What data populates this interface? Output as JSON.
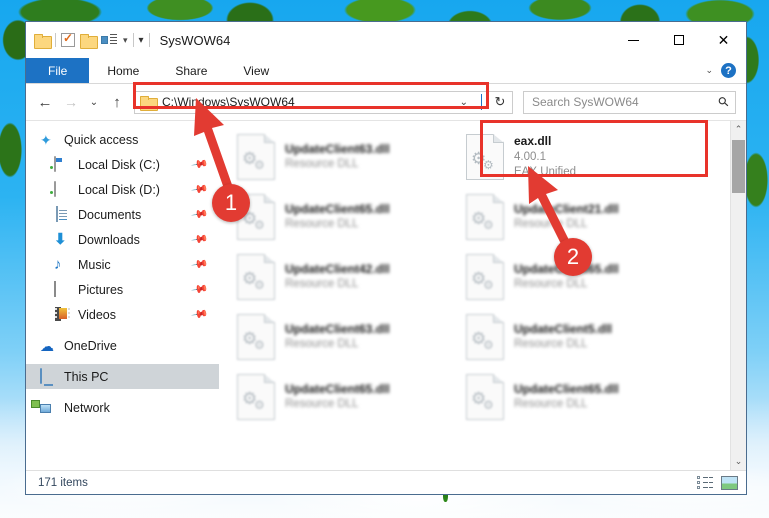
{
  "window": {
    "title": "SysWOW64",
    "quick_access_icons": [
      "folder-icon",
      "properties-icon",
      "new-folder-icon",
      "customize-ribbon-icon"
    ],
    "controls": {
      "minimize": "minimize",
      "maximize": "maximize",
      "close": "close"
    }
  },
  "ribbon": {
    "tabs": [
      {
        "label": "File",
        "active": true
      },
      {
        "label": "Home",
        "active": false
      },
      {
        "label": "Share",
        "active": false
      },
      {
        "label": "View",
        "active": false
      }
    ],
    "expand_label": "⌄",
    "help_label": "?"
  },
  "navigation": {
    "back": "←",
    "forward": "→",
    "recent": "⌄",
    "up": "↑",
    "address": {
      "value": "C:\\Windows\\SysWOW64",
      "chevron": "⌄",
      "refresh": "↻"
    },
    "search": {
      "placeholder": "Search SysWOW64",
      "value": "",
      "icon": "⚲"
    }
  },
  "sidebar": {
    "items": [
      {
        "label": "Quick access",
        "icon": "star-icon",
        "level": "root",
        "pinned": false,
        "selected": false
      },
      {
        "label": "Local Disk (C:)",
        "icon": "drive-icon",
        "level": "child",
        "pinned": true,
        "selected": false
      },
      {
        "label": "Local Disk (D:)",
        "icon": "drive-icon",
        "level": "child",
        "pinned": true,
        "selected": false
      },
      {
        "label": "Documents",
        "icon": "documents-icon",
        "level": "child",
        "pinned": true,
        "selected": false
      },
      {
        "label": "Downloads",
        "icon": "downloads-icon",
        "level": "child",
        "pinned": true,
        "selected": false
      },
      {
        "label": "Music",
        "icon": "music-icon",
        "level": "child",
        "pinned": true,
        "selected": false
      },
      {
        "label": "Pictures",
        "icon": "pictures-icon",
        "level": "child",
        "pinned": true,
        "selected": false
      },
      {
        "label": "Videos",
        "icon": "videos-icon",
        "level": "child",
        "pinned": true,
        "selected": false
      },
      {
        "label": "OneDrive",
        "icon": "cloud-icon",
        "level": "root",
        "pinned": false,
        "selected": false
      },
      {
        "label": "This PC",
        "icon": "this-pc-icon",
        "level": "root",
        "pinned": false,
        "selected": true
      },
      {
        "label": "Network",
        "icon": "network-icon",
        "level": "root",
        "pinned": false,
        "selected": false
      }
    ],
    "pin_glyph": "📌"
  },
  "files": [
    {
      "name": "UpdateClient63.dll",
      "line2": "Resource DLL",
      "line3": "",
      "icon": "dll-file-icon",
      "blurred": true,
      "highlighted": false
    },
    {
      "name": "eax.dll",
      "line2": "4.00.1",
      "line3": "EAX Unified",
      "icon": "dll-file-icon",
      "blurred": false,
      "highlighted": true
    },
    {
      "name": "UpdateClient65.dll",
      "line2": "Resource DLL",
      "line3": "",
      "icon": "dll-file-icon",
      "blurred": true,
      "highlighted": false
    },
    {
      "name": "UpdateClient21.dll",
      "line2": "Resource DLL",
      "line3": "",
      "icon": "dll-file-icon",
      "blurred": true,
      "highlighted": false
    },
    {
      "name": "UpdateClient42.dll",
      "line2": "Resource DLL",
      "line3": "",
      "icon": "dll-file-icon",
      "blurred": true,
      "highlighted": false
    },
    {
      "name": "UpdateClient65.dll",
      "line2": "Resource DLL",
      "line3": "",
      "icon": "dll-file-icon",
      "blurred": true,
      "highlighted": false
    },
    {
      "name": "UpdateClient63.dll",
      "line2": "Resource DLL",
      "line3": "",
      "icon": "dll-file-icon",
      "blurred": true,
      "highlighted": false
    },
    {
      "name": "UpdateClient5.dll",
      "line2": "Resource DLL",
      "line3": "",
      "icon": "dll-file-icon",
      "blurred": true,
      "highlighted": false
    },
    {
      "name": "UpdateClient65.dll",
      "line2": "Resource DLL",
      "line3": "",
      "icon": "dll-file-icon",
      "blurred": true,
      "highlighted": false
    },
    {
      "name": "UpdateClient65.dll",
      "line2": "Resource DLL",
      "line3": "",
      "icon": "dll-file-icon",
      "blurred": true,
      "highlighted": false
    }
  ],
  "statusbar": {
    "item_count": "171 items",
    "view_details_label": "details-view",
    "view_tiles_label": "large-icons-view"
  },
  "annotations": {
    "accent_color": "#e8332a",
    "badge_color": "#e23b32",
    "steps": [
      {
        "number": "1",
        "target": "address-bar"
      },
      {
        "number": "2",
        "target": "eax-dll-file"
      }
    ]
  },
  "scrollbar": {
    "up_arrow": "⌃",
    "down_arrow": "⌄"
  }
}
